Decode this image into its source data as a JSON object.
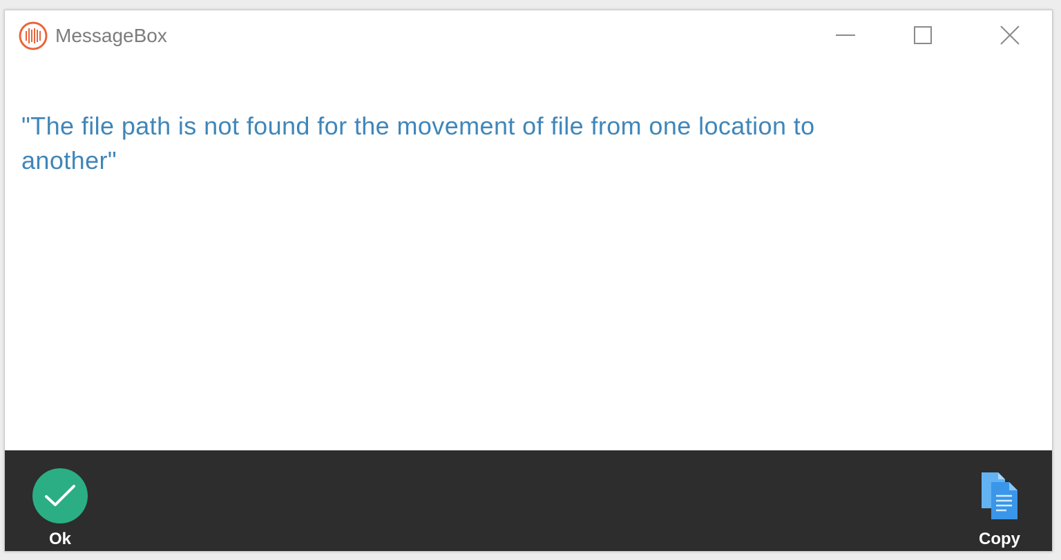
{
  "window": {
    "title": "MessageBox",
    "app_icon": "messagebox-app-icon",
    "controls": {
      "minimize_icon": "minimize-icon",
      "maximize_icon": "maximize-icon",
      "close_icon": "close-icon"
    }
  },
  "message": {
    "text": "\"The file path is not found for the movement of file from one location to another\""
  },
  "footer": {
    "ok_label": "Ok",
    "ok_icon": "checkmark-icon",
    "copy_label": "Copy",
    "copy_icon": "copy-documents-icon"
  },
  "colors": {
    "message_text": "#3f86b9",
    "footer_bg": "#2d2d2d",
    "ok_green": "#2bae84",
    "copy_blue": "#3a96e8",
    "app_icon_orange": "#e8653a"
  }
}
